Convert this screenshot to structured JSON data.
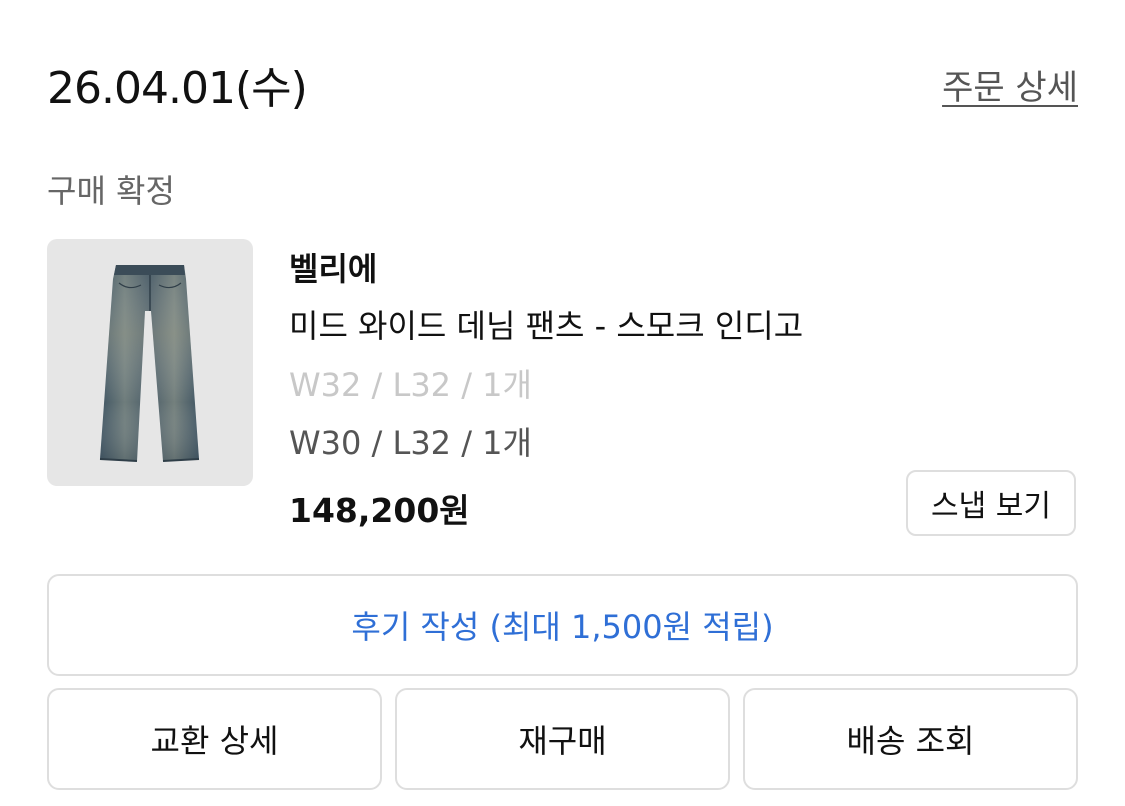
{
  "order": {
    "date": "26.04.01(수)",
    "detail_link": "주문 상세",
    "status": "구매 확정"
  },
  "product": {
    "image_icon": "denim-pants-image",
    "brand": "벨리에",
    "name": "미드 와이드 데님 팬츠 - 스모크 인디고",
    "option_before": "W32 / L32 / 1개",
    "option_after": "W30 / L32 / 1개",
    "price": "148,200원",
    "snap_button": "스냅 보기"
  },
  "review_button": "후기 작성 (최대 1,500원 적립)",
  "actions": {
    "exchange_detail": "교환 상세",
    "repurchase": "재구매",
    "delivery_tracking": "배송 조회"
  },
  "colors": {
    "accent_blue": "#2f6fd6",
    "border": "#dedede",
    "thumb_bg": "#e6e6e6",
    "muted_text": "#666666",
    "disabled_text": "#c8c8c8"
  }
}
